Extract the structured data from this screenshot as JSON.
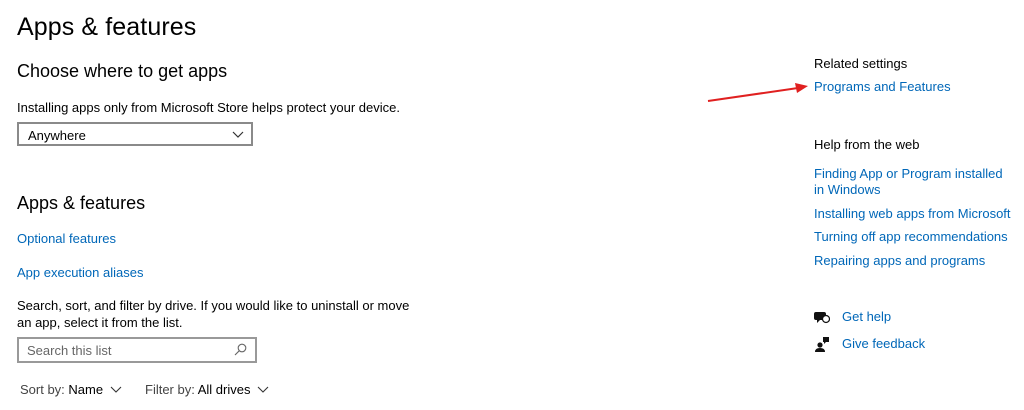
{
  "page": {
    "title": "Apps & features"
  },
  "choose_section": {
    "heading": "Choose where to get apps",
    "description": "Installing apps only from Microsoft Store helps protect your device.",
    "dropdown_value": "Anywhere"
  },
  "apps_section": {
    "heading": "Apps & features",
    "optional_features": "Optional features",
    "app_execution_aliases": "App execution aliases",
    "description": "Search, sort, and filter by drive. If you would like to uninstall or move an app, select it from the list.",
    "search_placeholder": "Search this list",
    "sort_label": "Sort by:",
    "sort_value": "Name",
    "filter_label": "Filter by:",
    "filter_value": "All drives"
  },
  "sidebar": {
    "related_heading": "Related settings",
    "programs_and_features": "Programs and Features",
    "web_heading": "Help from the web",
    "web_links": [
      "Finding App or Program installed in Windows",
      "Installing web apps from Microsoft",
      "Turning off app recommendations",
      "Repairing apps and programs"
    ],
    "get_help": "Get help",
    "give_feedback": "Give feedback"
  },
  "colors": {
    "link": "#0067b8",
    "annotation_arrow": "#e02020"
  }
}
